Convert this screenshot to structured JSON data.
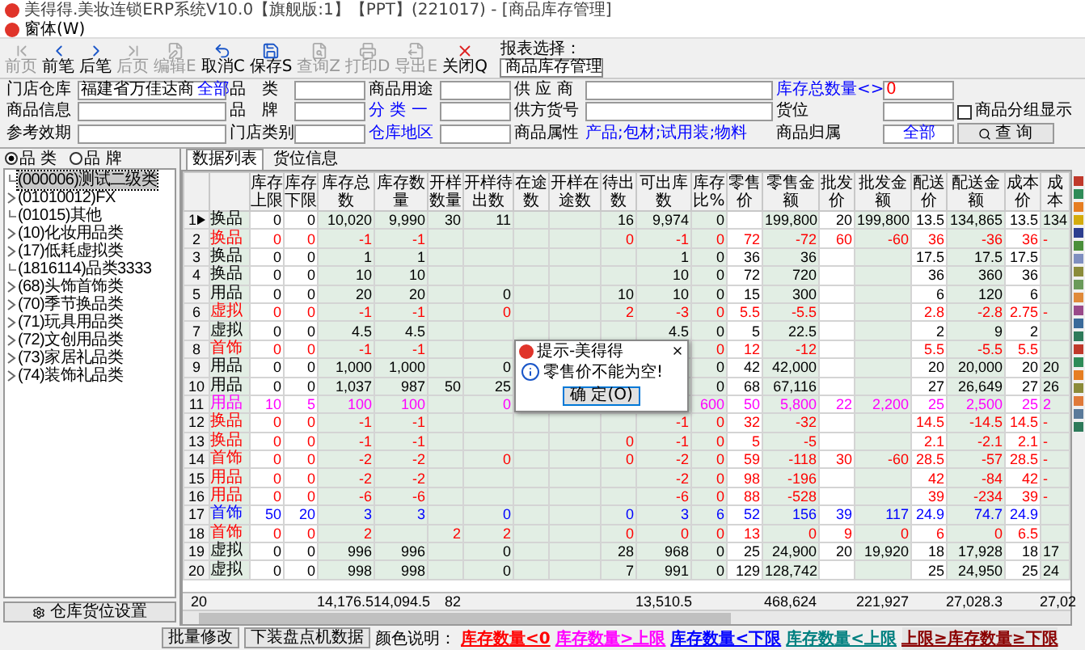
{
  "window": {
    "title": "美得得.美妆连锁ERP系统V10.0【旗舰版:1】【PPT】(221017) - [商品库存管理]"
  },
  "menu": [
    {
      "label": "窗体(W)"
    }
  ],
  "toolbar": [
    {
      "label": "前页",
      "kind": "first",
      "disabled": true
    },
    {
      "label": "前笔",
      "kind": "prev",
      "disabled": false
    },
    {
      "label": "后笔",
      "kind": "next",
      "disabled": false
    },
    {
      "label": "后页",
      "kind": "last",
      "disabled": true
    },
    {
      "label": "编辑E",
      "kind": "edit",
      "disabled": true
    },
    {
      "label": "取消C",
      "kind": "cancel",
      "disabled": false
    },
    {
      "label": "保存S",
      "kind": "save",
      "disabled": false
    },
    {
      "label": "查询Z",
      "kind": "query",
      "disabled": true
    },
    {
      "label": "打印D",
      "kind": "print",
      "disabled": true
    },
    {
      "label": "导出E",
      "kind": "export",
      "disabled": true
    },
    {
      "label": "关闭Q",
      "kind": "close",
      "disabled": false
    }
  ],
  "report_select": {
    "label": "报表选择：",
    "value": "商品库存管理"
  },
  "filters": [
    [
      {
        "kind": "label",
        "text": "门店仓库"
      },
      {
        "kind": "field",
        "value": "福建省万佳达商",
        "chip": "全部"
      },
      {
        "kind": "label",
        "text": "品　类"
      },
      {
        "kind": "field"
      },
      {
        "kind": "label",
        "text": "商品用途"
      },
      {
        "kind": "field"
      },
      {
        "kind": "label",
        "text": "供 应 商"
      },
      {
        "kind": "field"
      },
      {
        "kind": "link",
        "text": "库存总数量<>"
      },
      {
        "kind": "alert_field",
        "value": "0"
      }
    ],
    [
      {
        "kind": "label",
        "text": "商品信息"
      },
      {
        "kind": "field"
      },
      {
        "kind": "label",
        "text": "品　牌"
      },
      {
        "kind": "field"
      },
      {
        "kind": "link",
        "text": "分 类 一"
      },
      {
        "kind": "field"
      },
      {
        "kind": "label",
        "text": "供方货号"
      },
      {
        "kind": "field"
      },
      {
        "kind": "label",
        "text": "货位"
      },
      {
        "kind": "field"
      },
      {
        "kind": "checkbox",
        "text": "商品分组显示",
        "checked": false
      }
    ],
    [
      {
        "kind": "label",
        "text": "参考效期"
      },
      {
        "kind": "field"
      },
      {
        "kind": "label",
        "text": "门店类别"
      },
      {
        "kind": "field"
      },
      {
        "kind": "link",
        "text": "仓库地区"
      },
      {
        "kind": "field"
      },
      {
        "kind": "label",
        "text": "商品属性"
      },
      {
        "kind": "link",
        "text": "产品;包材;试用装;物料"
      },
      {
        "kind": "label",
        "text": "商品归属"
      },
      {
        "kind": "select",
        "value": "全部"
      },
      {
        "kind": "button",
        "text": "查 询"
      }
    ]
  ],
  "category_mode": [
    {
      "label": "品 类",
      "selected": true
    },
    {
      "label": "品 牌",
      "selected": false
    }
  ],
  "tree": [
    {
      "label": "(000006)测试二级类",
      "kind": "leaf",
      "selected": true
    },
    {
      "label": "(01010012)FX",
      "kind": "folder",
      "selected": false
    },
    {
      "label": "(01015)其他",
      "kind": "leaf",
      "selected": false
    },
    {
      "label": "(10)化妆用品类",
      "kind": "folder",
      "selected": false
    },
    {
      "label": "(17)低耗虚拟类",
      "kind": "folder",
      "selected": false
    },
    {
      "label": "(1816114)品类3333",
      "kind": "leaf",
      "selected": false
    },
    {
      "label": "(68)头饰首饰类",
      "kind": "folder",
      "selected": false
    },
    {
      "label": "(70)季节换品类",
      "kind": "folder",
      "selected": false
    },
    {
      "label": "(71)玩具用品类",
      "kind": "folder",
      "selected": false
    },
    {
      "label": "(72)文创用品类",
      "kind": "folder",
      "selected": false
    },
    {
      "label": "(73)家居礼品类",
      "kind": "folder",
      "selected": false
    },
    {
      "label": "(74)装饰礼品类",
      "kind": "folder",
      "selected": false
    }
  ],
  "left_button": "仓库货位设置",
  "tabs": [
    {
      "label": "数据列表",
      "selected": true
    },
    {
      "label": "货位信息",
      "selected": false
    }
  ],
  "columns": [
    {
      "label": "库存上限",
      "editable": true
    },
    {
      "label": "库存下限",
      "editable": true
    },
    {
      "label": "库存总数",
      "editable": false
    },
    {
      "label": "库存数量",
      "editable": false
    },
    {
      "label": "开样数量",
      "editable": false
    },
    {
      "label": "开样待出数",
      "editable": false
    },
    {
      "label": "在途数",
      "editable": false
    },
    {
      "label": "开样在途数",
      "editable": false
    },
    {
      "label": "待出数",
      "editable": false
    },
    {
      "label": "可出库数",
      "editable": false
    },
    {
      "label": "库存比%",
      "editable": false
    },
    {
      "label": "零售价",
      "editable": true
    },
    {
      "label": "零售金额",
      "editable": false
    },
    {
      "label": "批发价",
      "editable": true
    },
    {
      "label": "批发金额",
      "editable": false
    },
    {
      "label": "配送价",
      "editable": true
    },
    {
      "label": "配送金额",
      "editable": false
    },
    {
      "label": "成本价",
      "editable": true
    },
    {
      "label": "成本",
      "editable": false
    }
  ],
  "rows": [
    {
      "no": "1",
      "name": "换品",
      "color": "#000000",
      "selected": true,
      "cells": [
        "0",
        "0",
        "10,020",
        "9,990",
        "30",
        "11",
        "",
        "",
        "16",
        "9,974",
        "0",
        "",
        "199,800",
        "20",
        "199,800",
        "13.5",
        "134,865",
        "13.5",
        "134"
      ]
    },
    {
      "no": "2",
      "name": "换品",
      "color": "#ff0000",
      "selected": false,
      "cells": [
        "0",
        "0",
        "-1",
        "-1",
        "",
        "",
        "",
        "",
        "0",
        "-1",
        "0",
        "72",
        "-72",
        "60",
        "-60",
        "36",
        "-36",
        "36",
        "-"
      ]
    },
    {
      "no": "3",
      "name": "换品",
      "color": "#000000",
      "selected": false,
      "cells": [
        "0",
        "0",
        "1",
        "1",
        "",
        "",
        "",
        "",
        "",
        "1",
        "0",
        "36",
        "36",
        "",
        "",
        "17.5",
        "17.5",
        "17.5",
        ""
      ]
    },
    {
      "no": "4",
      "name": "换品",
      "color": "#000000",
      "selected": false,
      "cells": [
        "0",
        "0",
        "10",
        "10",
        "",
        "",
        "",
        "",
        "",
        "10",
        "0",
        "72",
        "720",
        "",
        "",
        "36",
        "360",
        "36",
        ""
      ]
    },
    {
      "no": "5",
      "name": "用品",
      "color": "#000000",
      "selected": false,
      "cells": [
        "0",
        "0",
        "20",
        "20",
        "",
        "0",
        "",
        "",
        "10",
        "10",
        "0",
        "15",
        "300",
        "",
        "",
        "6",
        "120",
        "6",
        ""
      ]
    },
    {
      "no": "6",
      "name": "虚拟",
      "color": "#ff0000",
      "selected": false,
      "cells": [
        "0",
        "0",
        "-1",
        "-1",
        "",
        "0",
        "",
        "",
        "2",
        "-3",
        "0",
        "5.5",
        "-5.5",
        "",
        "",
        "2.8",
        "-2.8",
        "2.75",
        "-"
      ]
    },
    {
      "no": "7",
      "name": "虚拟",
      "color": "#000000",
      "selected": false,
      "cells": [
        "0",
        "0",
        "4.5",
        "4.5",
        "",
        "",
        "",
        "",
        "",
        "4.5",
        "0",
        "5",
        "22.5",
        "",
        "",
        "2",
        "9",
        "2",
        ""
      ]
    },
    {
      "no": "8",
      "name": "首饰",
      "color": "#ff0000",
      "selected": false,
      "cells": [
        "0",
        "0",
        "-1",
        "-1",
        "",
        "",
        "",
        "",
        "",
        "",
        "0",
        "12",
        "-12",
        "",
        "",
        "5.5",
        "-5.5",
        "5.5",
        ""
      ]
    },
    {
      "no": "9",
      "name": "用品",
      "color": "#000000",
      "selected": false,
      "cells": [
        "0",
        "0",
        "1,000",
        "1,000",
        "",
        "0",
        "",
        "",
        "",
        "",
        "0",
        "42",
        "42,000",
        "",
        "",
        "20",
        "20,000",
        "20",
        "20"
      ]
    },
    {
      "no": "10",
      "name": "用品",
      "color": "#000000",
      "selected": false,
      "cells": [
        "0",
        "0",
        "1,037",
        "987",
        "50",
        "25",
        "",
        "",
        "",
        "",
        "0",
        "68",
        "67,116",
        "",
        "",
        "27",
        "26,649",
        "27",
        "26"
      ]
    },
    {
      "no": "11",
      "name": "用品",
      "color": "#ff00ff",
      "selected": false,
      "cells": [
        "10",
        "5",
        "100",
        "100",
        "",
        "0",
        "",
        "",
        "",
        "",
        "600",
        "50",
        "5,800",
        "22",
        "2,200",
        "25",
        "2,500",
        "25",
        "2"
      ]
    },
    {
      "no": "12",
      "name": "换品",
      "color": "#ff0000",
      "selected": false,
      "cells": [
        "0",
        "0",
        "-1",
        "-1",
        "",
        "",
        "",
        "",
        "",
        "-1",
        "0",
        "32",
        "-32",
        "",
        "",
        "14.5",
        "-14.5",
        "14.5",
        "-"
      ]
    },
    {
      "no": "13",
      "name": "换品",
      "color": "#ff0000",
      "selected": false,
      "cells": [
        "0",
        "0",
        "-1",
        "-1",
        "",
        "",
        "",
        "",
        "0",
        "-1",
        "0",
        "5",
        "-5",
        "",
        "",
        "2.1",
        "-2.1",
        "2.1",
        "-"
      ]
    },
    {
      "no": "14",
      "name": "首饰",
      "color": "#ff0000",
      "selected": false,
      "cells": [
        "0",
        "0",
        "-2",
        "-2",
        "",
        "0",
        "",
        "",
        "0",
        "-2",
        "0",
        "59",
        "-118",
        "30",
        "-60",
        "28.5",
        "-57",
        "28.5",
        "-"
      ]
    },
    {
      "no": "15",
      "name": "用品",
      "color": "#ff0000",
      "selected": false,
      "cells": [
        "0",
        "0",
        "-2",
        "-2",
        "",
        "",
        "",
        "",
        "",
        "-2",
        "0",
        "98",
        "-196",
        "",
        "",
        "42",
        "-84",
        "42",
        "-"
      ]
    },
    {
      "no": "16",
      "name": "用品",
      "color": "#ff0000",
      "selected": false,
      "cells": [
        "0",
        "0",
        "-6",
        "-6",
        "",
        "",
        "",
        "",
        "",
        "-6",
        "0",
        "88",
        "-528",
        "",
        "",
        "39",
        "-234",
        "39",
        "-"
      ]
    },
    {
      "no": "17",
      "name": "首饰",
      "color": "#0000ff",
      "selected": false,
      "cells": [
        "50",
        "20",
        "3",
        "3",
        "",
        "0",
        "",
        "",
        "0",
        "3",
        "6",
        "52",
        "156",
        "39",
        "117",
        "24.9",
        "74.7",
        "24.9",
        ""
      ]
    },
    {
      "no": "18",
      "name": "首饰",
      "color": "#ff0000",
      "selected": false,
      "cells": [
        "0",
        "0",
        "2",
        "",
        "2",
        "2",
        "",
        "",
        "0",
        "0",
        "0",
        "13",
        "0",
        "9",
        "0",
        "6",
        "0",
        "6.5",
        ""
      ]
    },
    {
      "no": "19",
      "name": "虚拟",
      "color": "#000000",
      "selected": false,
      "cells": [
        "0",
        "0",
        "996",
        "996",
        "",
        "0",
        "",
        "",
        "28",
        "968",
        "0",
        "25",
        "24,900",
        "20",
        "19,920",
        "18",
        "17,928",
        "18",
        "17"
      ]
    },
    {
      "no": "20",
      "name": "虚拟",
      "color": "#000000",
      "selected": false,
      "cells": [
        "0",
        "0",
        "998",
        "998",
        "",
        "0",
        "",
        "",
        "7",
        "991",
        "0",
        "129",
        "128,742",
        "",
        "",
        "25",
        "24,950",
        "25",
        "24"
      ]
    }
  ],
  "footer": {
    "count": "20",
    "cells": [
      "",
      "",
      "14,176.5",
      "14,094.5",
      "82",
      "",
      "",
      "",
      "",
      "13,510.5",
      "",
      "",
      "468,624",
      "",
      "221,927",
      "",
      "27,028.3",
      "",
      "27,02"
    ]
  },
  "dialog": {
    "title": "提示-美得得",
    "message": "零售价不能为空!",
    "button": "确 定(O)"
  },
  "bottom_buttons": [
    "批量修改",
    "下装盘点机数据"
  ],
  "legend": {
    "label": "颜色说明：",
    "items": [
      {
        "label": "库存数量<0",
        "color": "#ff0000"
      },
      {
        "label": "库存数量>上限",
        "color": "#ff00ff"
      },
      {
        "label": "库存数量<下限",
        "color": "#0000ff"
      },
      {
        "label": "库存数量<上限",
        "color": "#008080"
      },
      {
        "label": "上限≥库存数量≥下限",
        "color": "#8b0000"
      }
    ]
  }
}
